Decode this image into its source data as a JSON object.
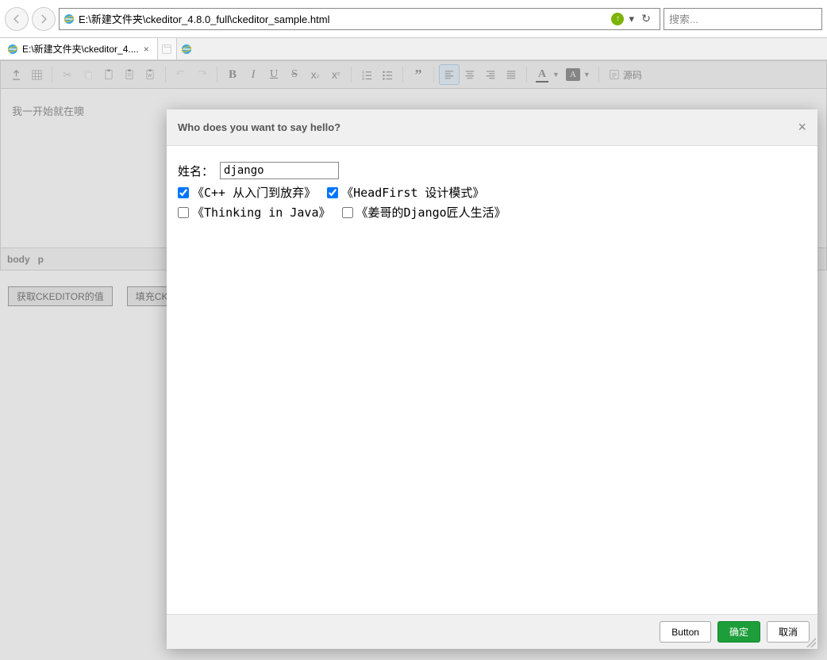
{
  "browser": {
    "url": "E:\\新建文件夹\\ckeditor_4.8.0_full\\ckeditor_sample.html",
    "search_placeholder": "搜索...",
    "tab_title": "E:\\新建文件夹\\ckeditor_4...."
  },
  "toolbar": {
    "source_label": "源码"
  },
  "editor": {
    "content": "我一开始就在噢",
    "path_body": "body",
    "path_p": "p"
  },
  "buttons": {
    "get_value": "获取CKEDITOR的值",
    "fill": "填充CK"
  },
  "dialog": {
    "title": "Who does you want to say hello?",
    "name_label": "姓名：",
    "name_value": "django",
    "books": [
      {
        "text": "《C++ 从入门到放弃》",
        "checked": true
      },
      {
        "text": "《HeadFirst 设计模式》",
        "checked": true
      },
      {
        "text": "《Thinking in Java》",
        "checked": false
      },
      {
        "text": "《姜哥的Django匠人生活》",
        "checked": false
      }
    ],
    "btn_button": "Button",
    "btn_ok": "确定",
    "btn_cancel": "取消"
  }
}
